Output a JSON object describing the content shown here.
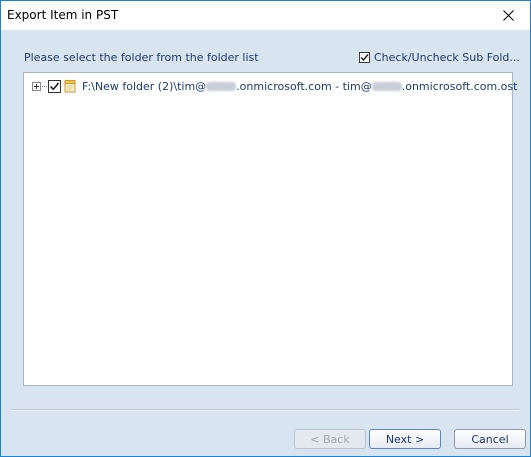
{
  "window": {
    "title": "Export Item in PST"
  },
  "main": {
    "instruction": "Please select the folder from the folder list",
    "check_subfolders_label": "Check/Uncheck Sub Fold...",
    "check_subfolders_checked": true
  },
  "tree": {
    "root": {
      "label_prefix": "F:\\New folder (2)\\tim@",
      "label_mid": ".onmicrosoft.com - tim@",
      "label_suffix": ".onmicrosoft.com.ost",
      "checked": true,
      "expanded": false
    }
  },
  "buttons": {
    "back": "< Back",
    "next": "Next >",
    "cancel": "Cancel"
  },
  "icons": {
    "close": "close-icon",
    "expander": "plus-icon",
    "pst": "pst-file-icon"
  }
}
